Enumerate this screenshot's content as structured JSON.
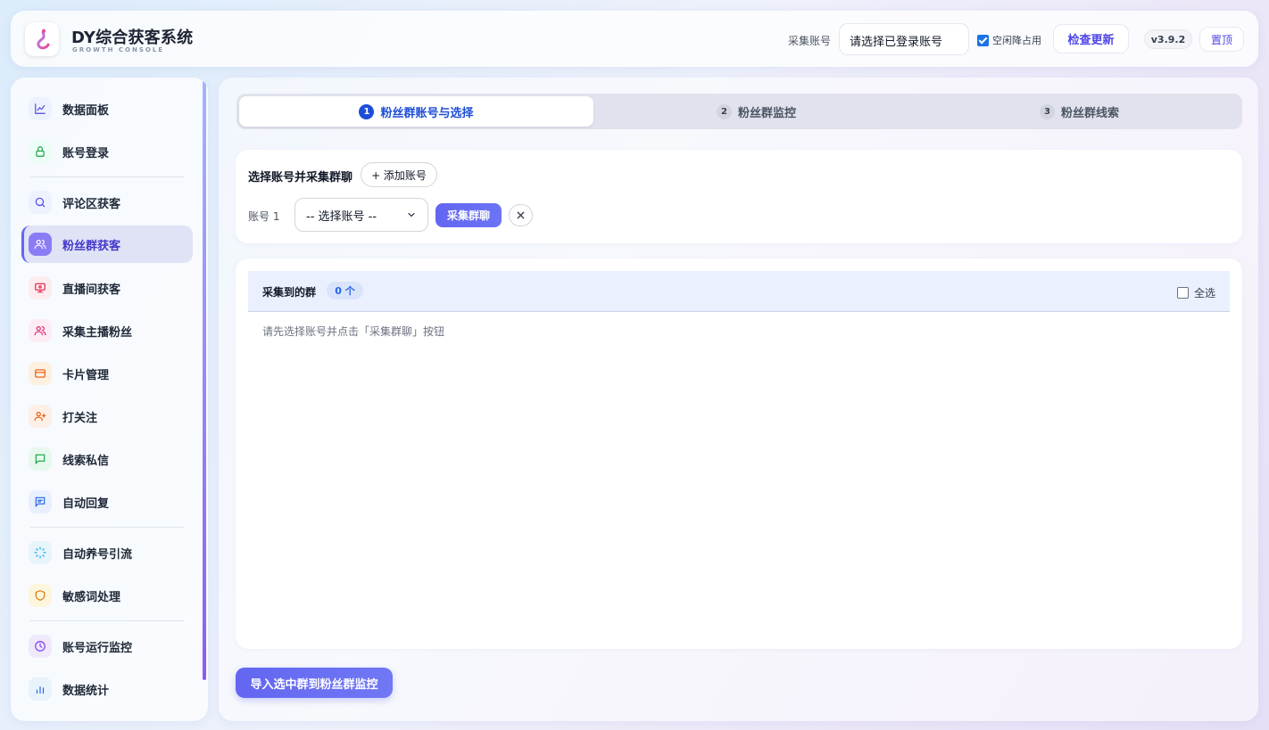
{
  "header": {
    "app_title": "DY综合获客系统",
    "app_subtitle": "GROWTH CONSOLE",
    "account_label": "采集账号",
    "account_select_value": "请选择已登录账号",
    "idle_label": "空闲降占用",
    "idle_checked": true,
    "update_button": "检查更新",
    "version": "v3.9.2",
    "top_button": "置顶"
  },
  "sidebar": {
    "items": [
      {
        "label": "数据面板",
        "icon": "chart-line-icon",
        "color": "#eef2ff",
        "stroke": "#4f46e5"
      },
      {
        "label": "账号登录",
        "icon": "lock-icon",
        "color": "#ecfdf5",
        "stroke": "#16a34a"
      },
      {
        "label": "评论区获客",
        "icon": "search-icon",
        "color": "#eef2ff",
        "stroke": "#4f46e5"
      },
      {
        "label": "粉丝群获客",
        "icon": "users-icon",
        "color": "#8b5cf6",
        "stroke": "#ffffff",
        "active": true
      },
      {
        "label": "直播间获客",
        "icon": "monitor-icon",
        "color": "#fdecee",
        "stroke": "#e11d48"
      },
      {
        "label": "采集主播粉丝",
        "icon": "users-icon",
        "color": "#fdecf3",
        "stroke": "#db2777"
      },
      {
        "label": "卡片管理",
        "icon": "card-icon",
        "color": "#fdf0e0",
        "stroke": "#ea580c"
      },
      {
        "label": "打关注",
        "icon": "user-plus-icon",
        "color": "#fdf0e6",
        "stroke": "#ea580c"
      },
      {
        "label": "线索私信",
        "icon": "message-icon",
        "color": "#e7f8ec",
        "stroke": "#16a34a"
      },
      {
        "label": "自动回复",
        "icon": "chat-reply-icon",
        "color": "#e8f0fd",
        "stroke": "#2563eb"
      },
      {
        "label": "自动养号引流",
        "icon": "loader-icon",
        "color": "#e7f5fb",
        "stroke": "#0ea5e9"
      },
      {
        "label": "敏感词处理",
        "icon": "shield-icon",
        "color": "#fdf5dc",
        "stroke": "#d97706"
      },
      {
        "label": "账号运行监控",
        "icon": "clock-icon",
        "color": "#efe9fb",
        "stroke": "#7c3aed"
      },
      {
        "label": "数据统计",
        "icon": "bar-chart-icon",
        "color": "#e8f3fb",
        "stroke": "#2563eb"
      }
    ]
  },
  "steps": [
    {
      "num": "1",
      "label": "粉丝群账号与选择",
      "active": true
    },
    {
      "num": "2",
      "label": "粉丝群监控"
    },
    {
      "num": "3",
      "label": "粉丝群线索"
    }
  ],
  "account_card": {
    "title": "选择账号并采集群聊",
    "add_button": "+ 添加账号",
    "account_row_label": "账号 1",
    "account_select_value": "-- 选择账号 --",
    "collect_button": "采集群聊"
  },
  "groups": {
    "title": "采集到的群",
    "count": "0 个",
    "select_all": "全选",
    "empty_hint": "请先选择账号并点击「采集群聊」按钮"
  },
  "import_button": "导入选中群到粉丝群监控"
}
